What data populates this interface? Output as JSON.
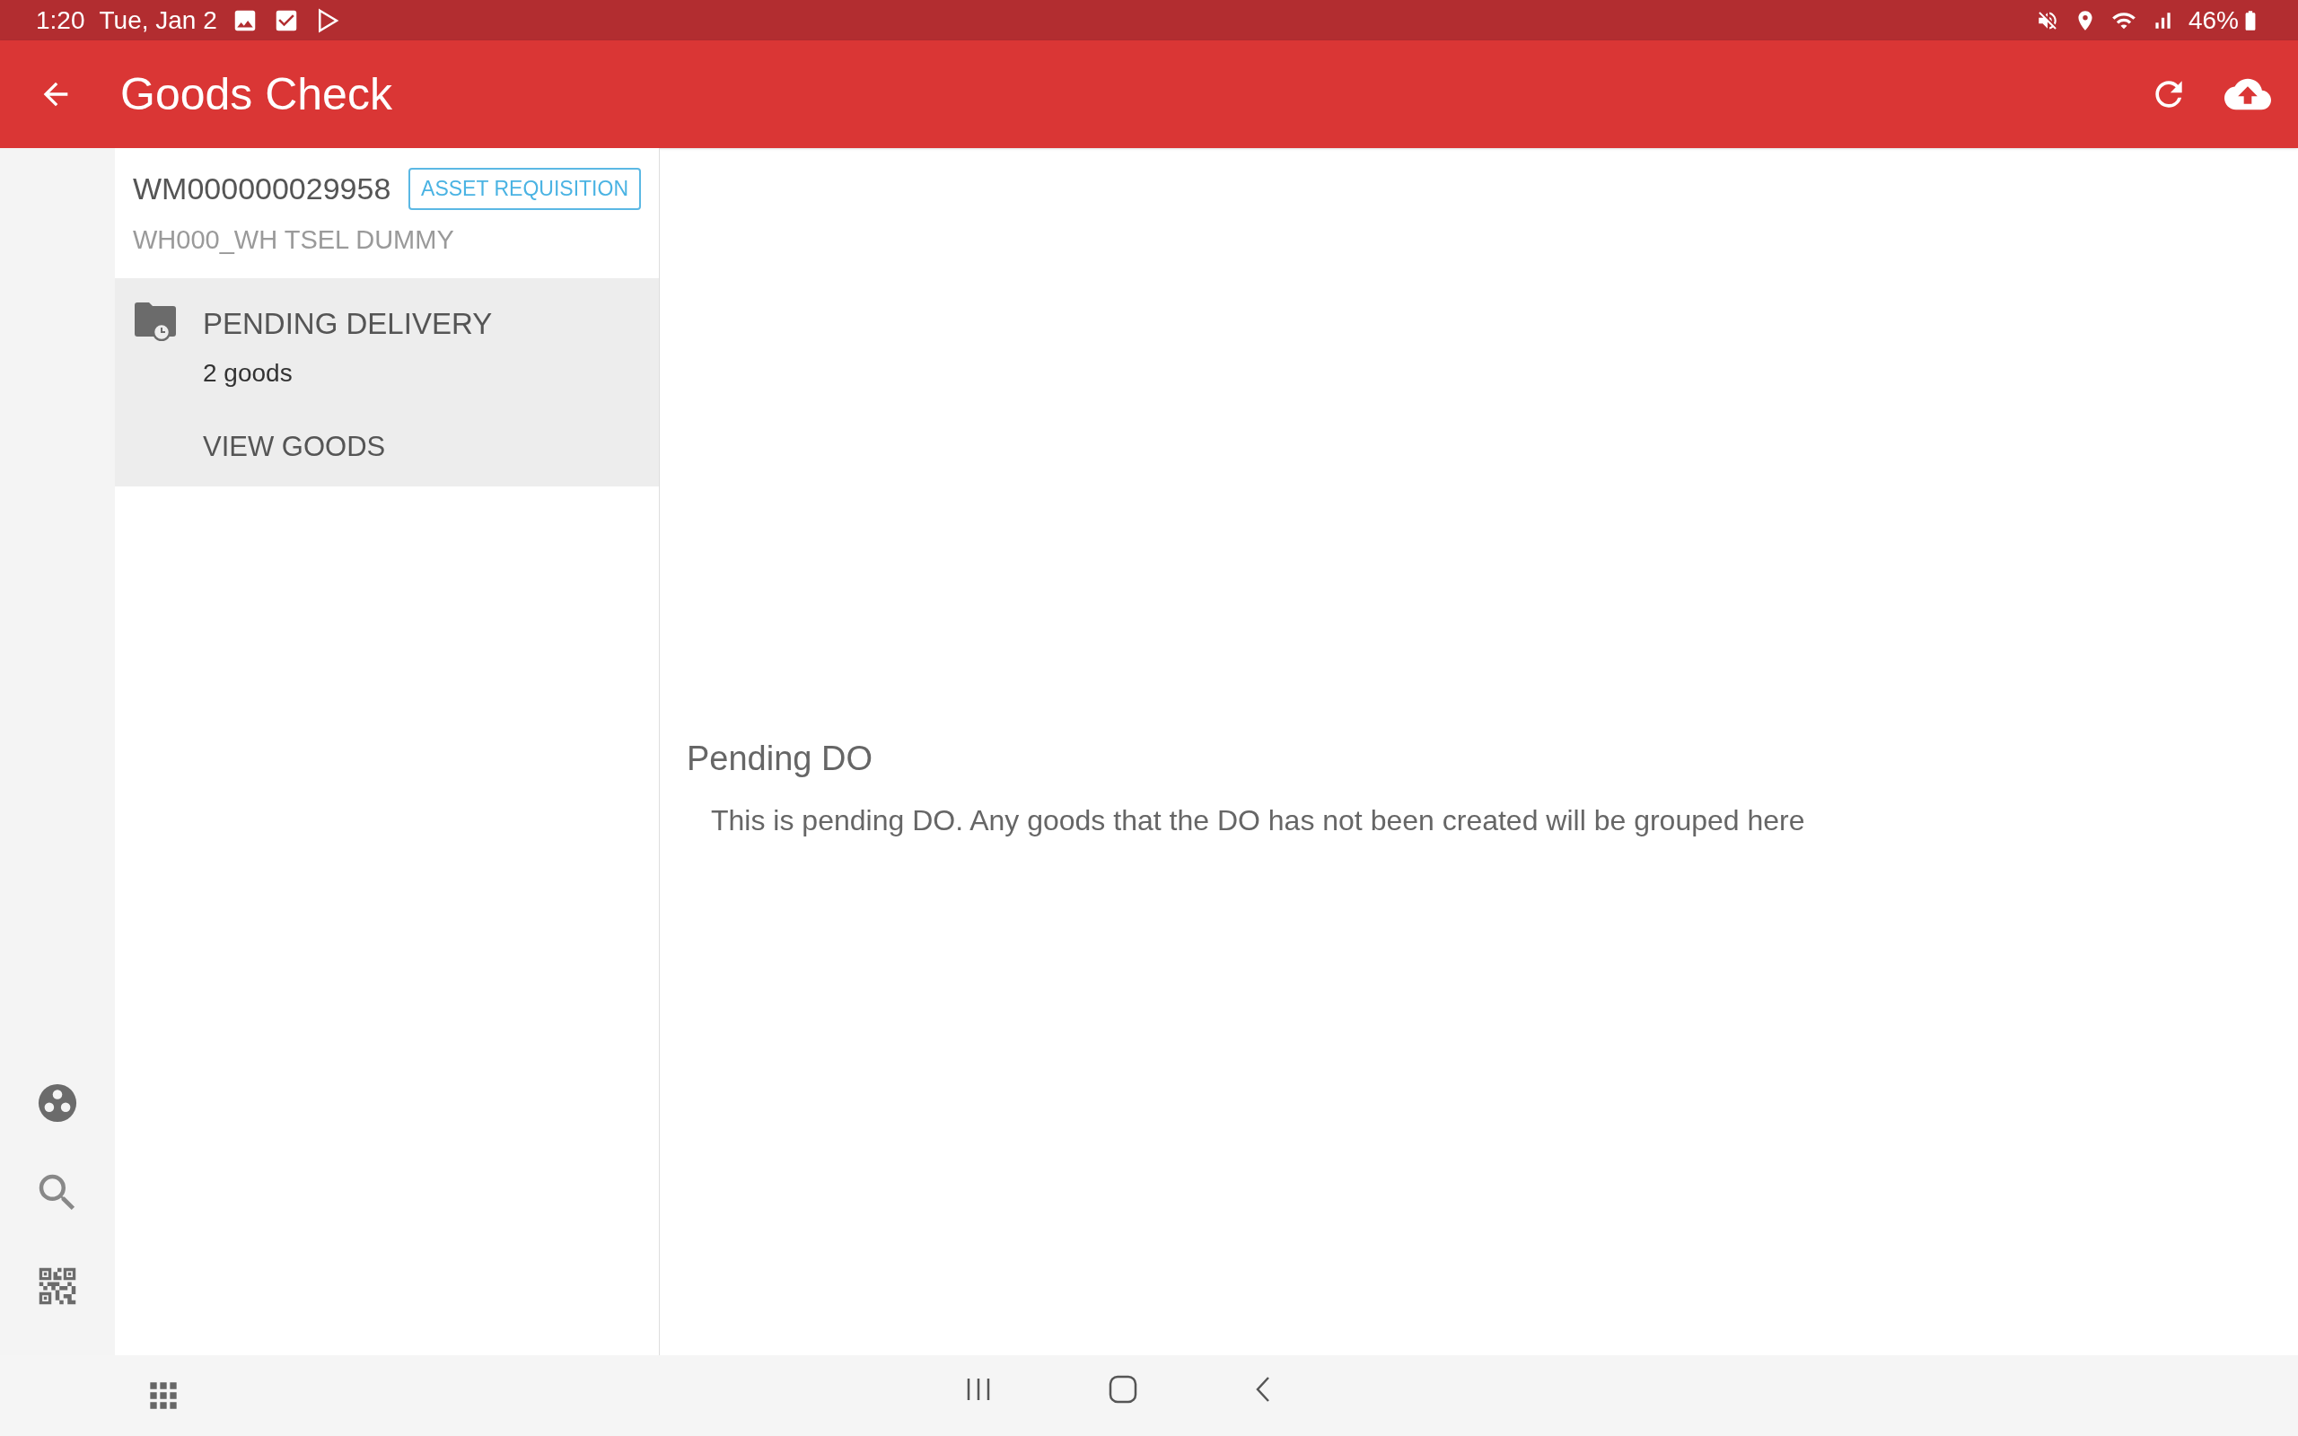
{
  "status_bar": {
    "time": "1:20",
    "date": "Tue, Jan 2",
    "battery": "46%"
  },
  "app_bar": {
    "title": "Goods Check"
  },
  "header": {
    "number": "WM000000029958",
    "badge": "ASSET REQUISITION",
    "warehouse": "WH000_WH TSEL DUMMY"
  },
  "groups": [
    {
      "title": "PENDING DELIVERY",
      "count": "2 goods",
      "action": "VIEW GOODS",
      "selected": true
    }
  ],
  "detail": {
    "title": "Pending DO",
    "description": "This is pending DO. Any goods that the DO has not been created will be grouped here"
  }
}
